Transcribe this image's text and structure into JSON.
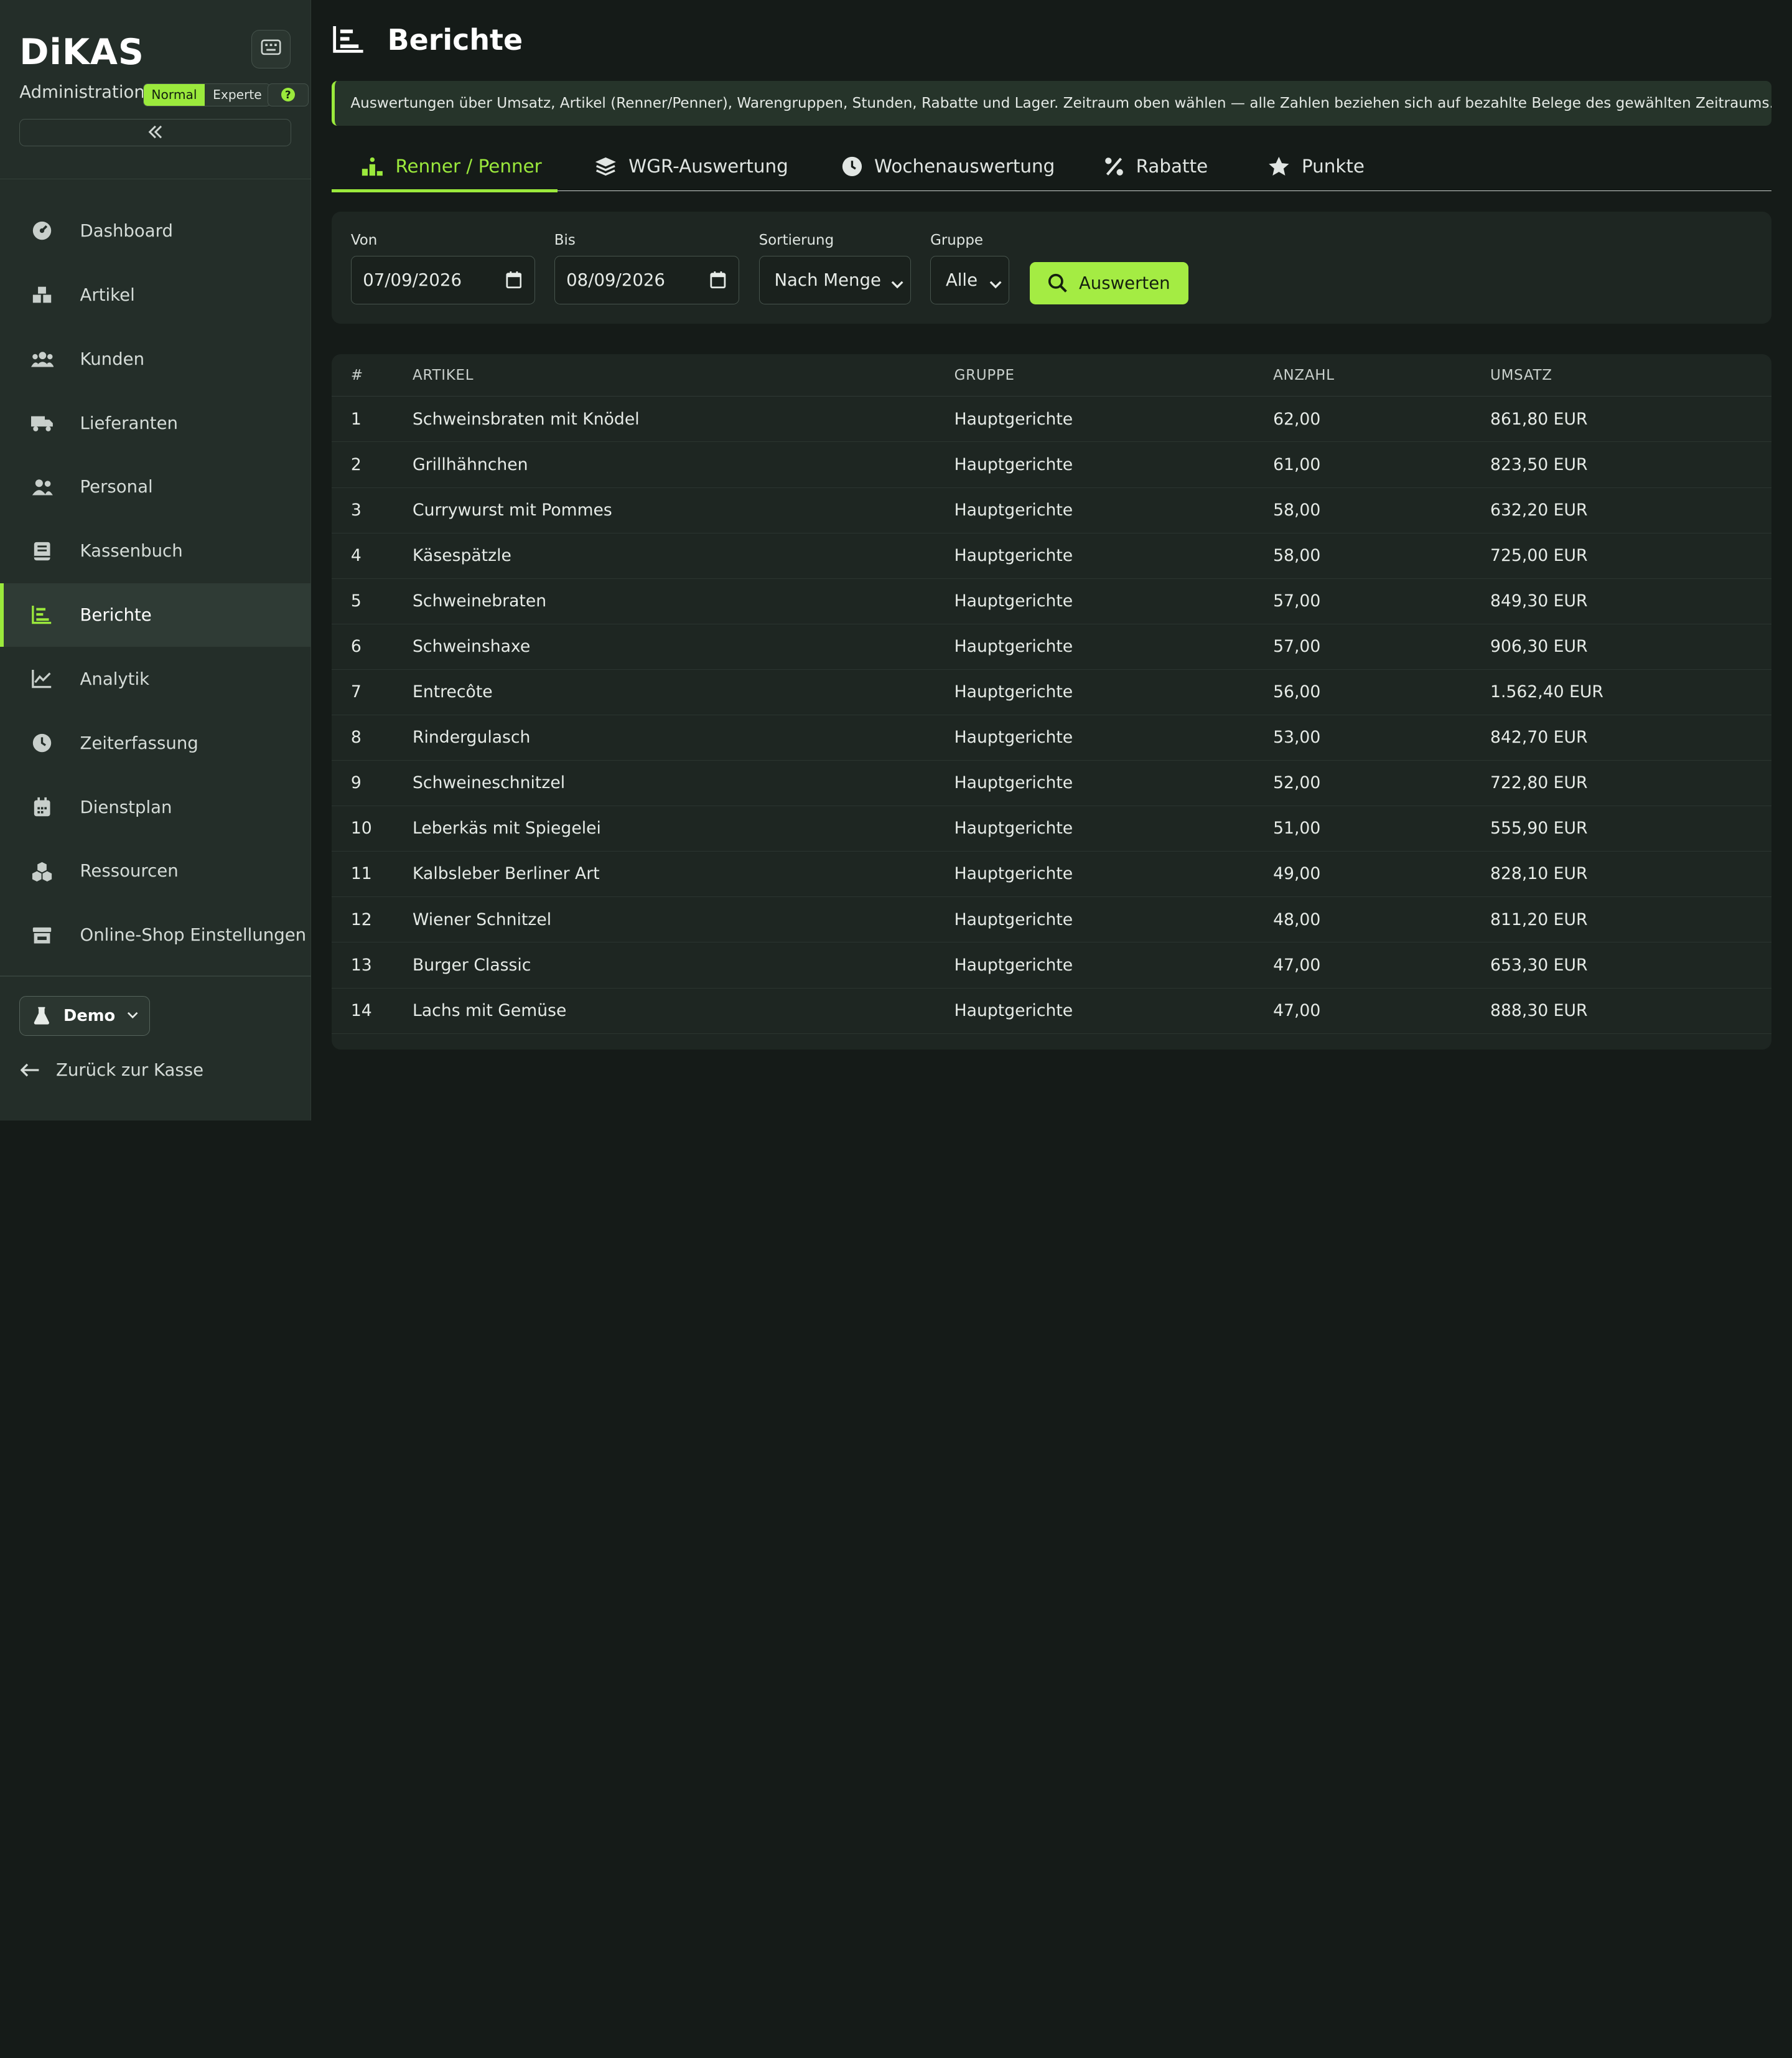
{
  "sidebar": {
    "brand": "DiKAS",
    "admin_label": "Administration",
    "mode_normal": "Normal",
    "mode_expert": "Experte",
    "help_label": "?",
    "items": [
      {
        "label": "Dashboard",
        "icon": "gauge-icon"
      },
      {
        "label": "Artikel",
        "icon": "boxes-icon"
      },
      {
        "label": "Kunden",
        "icon": "users-icon"
      },
      {
        "label": "Lieferanten",
        "icon": "truck-icon"
      },
      {
        "label": "Personal",
        "icon": "user-group-icon"
      },
      {
        "label": "Kassenbuch",
        "icon": "book-icon"
      },
      {
        "label": "Berichte",
        "icon": "chart-bar-icon",
        "active": true
      },
      {
        "label": "Analytik",
        "icon": "chart-line-icon"
      },
      {
        "label": "Zeiterfassung",
        "icon": "clock-icon"
      },
      {
        "label": "Dienstplan",
        "icon": "calendar-icon"
      },
      {
        "label": "Ressourcen",
        "icon": "cubes-icon"
      },
      {
        "label": "Online-Shop Einstellungen",
        "icon": "store-icon"
      }
    ],
    "demo_label": "Demo",
    "back_label": "Zurück zur Kasse"
  },
  "header": {
    "title": "Berichte",
    "info": "Auswertungen über Umsatz, Artikel (Renner/Penner), Warengruppen, Stunden, Rabatte und Lager. Zeitraum oben wählen — alle Zahlen beziehen sich auf bezahlte Belege des gewählten Zeitraums."
  },
  "tabs": [
    {
      "label": "Renner / Penner",
      "active": true
    },
    {
      "label": "WGR-Auswertung"
    },
    {
      "label": "Wochenauswertung"
    },
    {
      "label": "Rabatte"
    },
    {
      "label": "Punkte"
    }
  ],
  "filters": {
    "von_label": "Von",
    "von_value": "07/09/2026",
    "bis_label": "Bis",
    "bis_value": "08/09/2026",
    "sort_label": "Sortierung",
    "sort_value": "Nach Menge",
    "group_label": "Gruppe",
    "group_value": "Alle",
    "submit_label": "Auswerten"
  },
  "table": {
    "headers": {
      "num": "#",
      "artikel": "ARTIKEL",
      "gruppe": "GRUPPE",
      "anzahl": "ANZAHL",
      "umsatz": "UMSATZ"
    },
    "rows": [
      {
        "num": "1",
        "artikel": "Schweinsbraten mit Knödel",
        "gruppe": "Hauptgerichte",
        "anzahl": "62,00",
        "umsatz": "861,80 EUR"
      },
      {
        "num": "2",
        "artikel": "Grillhähnchen",
        "gruppe": "Hauptgerichte",
        "anzahl": "61,00",
        "umsatz": "823,50 EUR"
      },
      {
        "num": "3",
        "artikel": "Currywurst mit Pommes",
        "gruppe": "Hauptgerichte",
        "anzahl": "58,00",
        "umsatz": "632,20 EUR"
      },
      {
        "num": "4",
        "artikel": "Käsespätzle",
        "gruppe": "Hauptgerichte",
        "anzahl": "58,00",
        "umsatz": "725,00 EUR"
      },
      {
        "num": "5",
        "artikel": "Schweinebraten",
        "gruppe": "Hauptgerichte",
        "anzahl": "57,00",
        "umsatz": "849,30 EUR"
      },
      {
        "num": "6",
        "artikel": "Schweinshaxe",
        "gruppe": "Hauptgerichte",
        "anzahl": "57,00",
        "umsatz": "906,30 EUR"
      },
      {
        "num": "7",
        "artikel": "Entrecôte",
        "gruppe": "Hauptgerichte",
        "anzahl": "56,00",
        "umsatz": "1.562,40 EUR"
      },
      {
        "num": "8",
        "artikel": "Rindergulasch",
        "gruppe": "Hauptgerichte",
        "anzahl": "53,00",
        "umsatz": "842,70 EUR"
      },
      {
        "num": "9",
        "artikel": "Schweineschnitzel",
        "gruppe": "Hauptgerichte",
        "anzahl": "52,00",
        "umsatz": "722,80 EUR"
      },
      {
        "num": "10",
        "artikel": "Leberkäs mit Spiegelei",
        "gruppe": "Hauptgerichte",
        "anzahl": "51,00",
        "umsatz": "555,90 EUR"
      },
      {
        "num": "11",
        "artikel": "Kalbsleber Berliner Art",
        "gruppe": "Hauptgerichte",
        "anzahl": "49,00",
        "umsatz": "828,10 EUR"
      },
      {
        "num": "12",
        "artikel": "Wiener Schnitzel",
        "gruppe": "Hauptgerichte",
        "anzahl": "48,00",
        "umsatz": "811,20 EUR"
      },
      {
        "num": "13",
        "artikel": "Burger Classic",
        "gruppe": "Hauptgerichte",
        "anzahl": "47,00",
        "umsatz": "653,30 EUR"
      },
      {
        "num": "14",
        "artikel": "Lachs mit Gemüse",
        "gruppe": "Hauptgerichte",
        "anzahl": "47,00",
        "umsatz": "888,30 EUR"
      }
    ]
  },
  "colors": {
    "accent": "#9be93c",
    "background": "#151b18",
    "sidebar": "#242e29"
  }
}
